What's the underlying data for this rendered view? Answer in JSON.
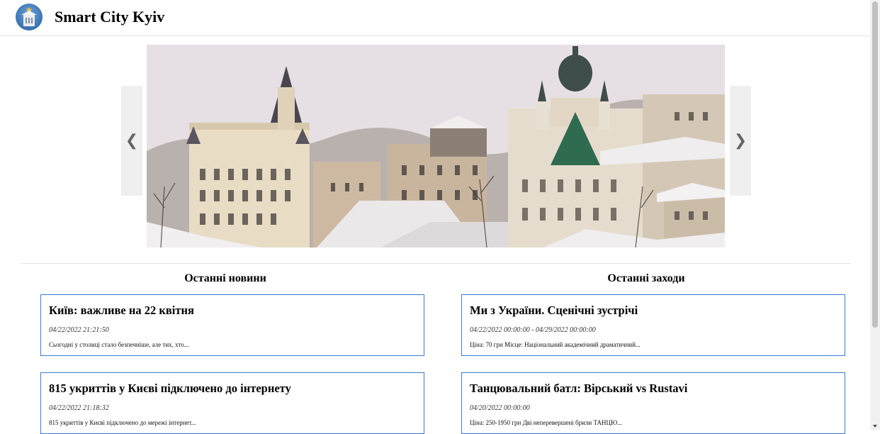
{
  "header": {
    "title": "Smart City Kyiv",
    "logo": "kyiv-coat-of-arms-icon"
  },
  "carousel": {
    "prev_label": "❮",
    "next_label": "❯",
    "image": "kyiv-andriyivskyy-descent-winter-panorama"
  },
  "news": {
    "heading": "Останні новини",
    "items": [
      {
        "title": "Київ: важливе на 22 квітня",
        "date": "04/22/2022 21:21:50",
        "excerpt": "Сьогодні у столиці стало безпечніше, але тих, хто..."
      },
      {
        "title": "815 укриттів у Києві підключено до інтернету",
        "date": "04/22/2022 21:18:32",
        "excerpt": "815 укриттів у Києві підключено до мережі інтернет..."
      }
    ]
  },
  "events": {
    "heading": "Останні заходи",
    "items": [
      {
        "title": "Ми з України. Сценічні зустрічі",
        "date": "04/22/2022 00:00:00 - 04/29/2022 00:00:00",
        "excerpt": "Ціна: 70 грн Місце: Національний академічний драматичний..."
      },
      {
        "title": "Танцювальний батл: Вірський vs Rustavi",
        "date": "04/20/2022 00:00:00",
        "excerpt": "Ціна: 250-1950 грн Дві неперевершені брили ТАНЦЮ..."
      }
    ]
  },
  "colors": {
    "card_border": "#3a7bd5",
    "divider": "#e2e2e2",
    "arrow_bg": "#efefef"
  }
}
